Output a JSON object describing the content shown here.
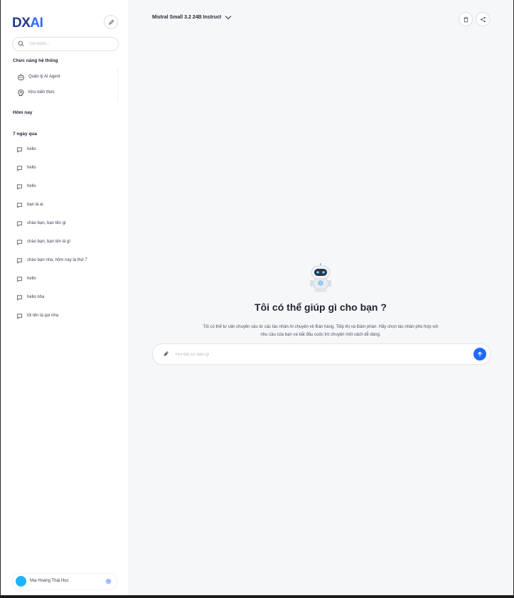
{
  "brand": {
    "logo_part1": "DX",
    "logo_part2": "AI",
    "color_dark": "#1f3a8a",
    "color_accent": "#2f6bff"
  },
  "sidebar": {
    "search_placeholder": "Tìm kiếm...",
    "system_section_title": "Chức năng hệ thống",
    "system_items": [
      {
        "label": "Quản lý AI Agent",
        "icon": "robot-icon"
      },
      {
        "label": "Kho kiến thức",
        "icon": "brain-icon"
      }
    ],
    "today_title": "Hôm nay",
    "week_title": "7 ngày qua",
    "chats": [
      {
        "label": "hello"
      },
      {
        "label": "hello"
      },
      {
        "label": "hello"
      },
      {
        "label": "bạn là ai"
      },
      {
        "label": "chào bạn, bạn tên gì"
      },
      {
        "label": "chào bạn, bạn tên là gì"
      },
      {
        "label": "chào bạn nha, hôm nay là thứ 7"
      },
      {
        "label": "hello"
      },
      {
        "label": "hello nha"
      },
      {
        "label": "tôi tên là qui nha"
      }
    ],
    "user": {
      "name": "Mai Hoàng Thái Học",
      "avatar_color": "#1fb3ff"
    }
  },
  "topbar": {
    "model_name": "Mistral Small 3.2 24B Instruct"
  },
  "main": {
    "headline": "Tôi có thể giúp gì cho bạn ?",
    "description": "Tôi có thể tư vấn chuyên sâu từ các tác nhân AI chuyên về Bán hàng, Tiếp thị và Đàm phán. Hãy chọn tác nhân phù hợp với nhu cầu của bạn và bắt đầu cuộc trò chuyện một cách dễ dàng.",
    "input_placeholder": "Hỏi bất cứ điều gì",
    "send_color": "#1f6bff"
  }
}
